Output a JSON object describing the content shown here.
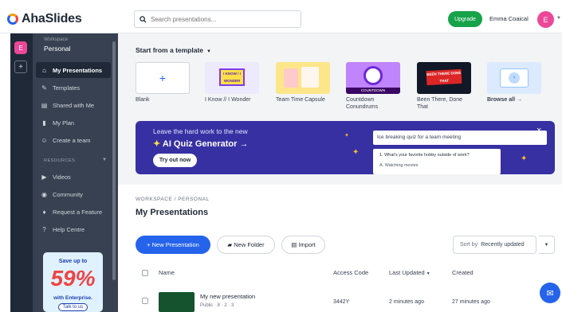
{
  "brand": {
    "name": "AhaSlides"
  },
  "search": {
    "placeholder": "Search presentations..."
  },
  "header": {
    "upgrade_label": "Upgrade",
    "user_name": "Emma Coaical",
    "avatar_initial": "E"
  },
  "workspace": {
    "badge": "E",
    "label": "Workspace",
    "name": "Personal"
  },
  "sidebar": {
    "items": [
      {
        "label": "My Presentations",
        "icon": "home-icon"
      },
      {
        "label": "Templates",
        "icon": "templates-icon"
      },
      {
        "label": "Shared with Me",
        "icon": "shared-icon"
      },
      {
        "label": "My Plan",
        "icon": "plan-icon"
      },
      {
        "label": "Create a team",
        "icon": "team-icon"
      }
    ],
    "resources_label": "RESOURCES",
    "resources": [
      {
        "label": "Videos",
        "icon": "video-icon"
      },
      {
        "label": "Community",
        "icon": "community-icon"
      },
      {
        "label": "Request a Feature",
        "icon": "bulb-icon"
      },
      {
        "label": "Help Centre",
        "icon": "help-icon"
      }
    ],
    "promo": {
      "save": "Save up to",
      "percent": "59%",
      "enterprise": "with Enterprise.",
      "cta": "Talk to us"
    }
  },
  "templates": {
    "title": "Start from a template",
    "items": [
      {
        "label": "Blank",
        "thumb_text": "+"
      },
      {
        "label": "I Know // I Wonder",
        "thumb_text": "I KNOW / I WONDER"
      },
      {
        "label": "Team Time Capsule",
        "thumb_text": ""
      },
      {
        "label": "Countdown Conundrums",
        "thumb_text": "COUNTDOWN"
      },
      {
        "label": "Been There, Done That",
        "thumb_text": "BEEN THERE DONE THAT"
      },
      {
        "label": "Browse all →",
        "thumb_text": ""
      }
    ]
  },
  "ai_banner": {
    "line1": "Leave the hard work to the new",
    "line2": "AI Quiz Generator →",
    "cta": "Try out now",
    "prompt": "Ice breaking quiz for a team meeting",
    "question": "1. What's your favorite hobby outside of work?",
    "answer": "A. Watching movies"
  },
  "breadcrumb": "WORKSPACE / PERSONAL",
  "page_title": "My Presentations",
  "actions": {
    "new_presentation": "+ New Presentation",
    "new_folder": "New Folder",
    "import": "Import"
  },
  "sort": {
    "label": "Sort by",
    "value": "Recently updated"
  },
  "table": {
    "columns": [
      "Name",
      "Access Code",
      "Last Updated",
      "Created"
    ],
    "rows": [
      {
        "name": "My new presentation",
        "meta": "Public · 8 · 2 · 3",
        "access_code": "3442Y",
        "last_updated": "2 minutes ago",
        "created": "27 minutes ago"
      }
    ]
  },
  "colors": {
    "accent": "#2563eb",
    "upgrade": "#16a34a",
    "sidebar": "#374151",
    "banner": "#3730a3"
  }
}
